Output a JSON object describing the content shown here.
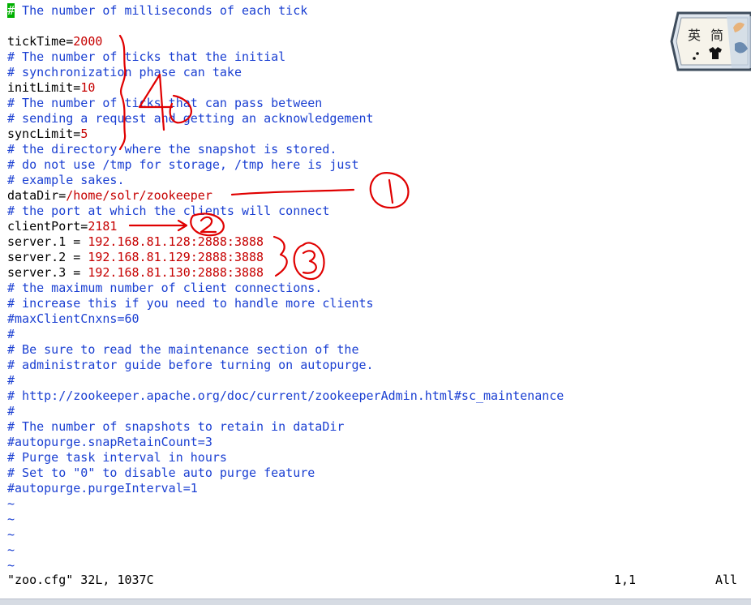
{
  "editor": {
    "lines": [
      {
        "type": "comment",
        "cursor": "#",
        "text": " The number of milliseconds of each tick"
      },
      {
        "type": "blank",
        "text": ""
      },
      {
        "type": "kv",
        "key": "tickTime=",
        "value": "2000"
      },
      {
        "type": "comment",
        "text": "# The number of ticks that the initial"
      },
      {
        "type": "comment",
        "text": "# synchronization phase can take"
      },
      {
        "type": "kv",
        "key": "initLimit=",
        "value": "10"
      },
      {
        "type": "comment",
        "text": "# The number of ticks that can pass between"
      },
      {
        "type": "comment",
        "text": "# sending a request and getting an acknowledgement"
      },
      {
        "type": "kv",
        "key": "syncLimit=",
        "value": "5"
      },
      {
        "type": "comment",
        "text": "# the directory where the snapshot is stored."
      },
      {
        "type": "comment",
        "text": "# do not use /tmp for storage, /tmp here is just"
      },
      {
        "type": "comment",
        "text": "# example sakes."
      },
      {
        "type": "kv",
        "key": "dataDir=",
        "value": "/home/solr/zookeeper"
      },
      {
        "type": "comment",
        "text": "# the port at which the clients will connect"
      },
      {
        "type": "kv",
        "key": "clientPort=",
        "value": "2181"
      },
      {
        "type": "kv",
        "key": "server.1 = ",
        "value": "192.168.81.128:2888:3888"
      },
      {
        "type": "kv",
        "key": "server.2 = ",
        "value": "192.168.81.129:2888:3888"
      },
      {
        "type": "kv",
        "key": "server.3 = ",
        "value": "192.168.81.130:2888:3888"
      },
      {
        "type": "comment",
        "text": "# the maximum number of client connections."
      },
      {
        "type": "comment",
        "text": "# increase this if you need to handle more clients"
      },
      {
        "type": "comment",
        "text": "#maxClientCnxns=60"
      },
      {
        "type": "comment",
        "text": "#"
      },
      {
        "type": "comment",
        "text": "# Be sure to read the maintenance section of the"
      },
      {
        "type": "comment",
        "text": "# administrator guide before turning on autopurge."
      },
      {
        "type": "comment",
        "text": "#"
      },
      {
        "type": "comment",
        "text": "# http://zookeeper.apache.org/doc/current/zookeeperAdmin.html#sc_maintenance"
      },
      {
        "type": "comment",
        "text": "#"
      },
      {
        "type": "comment",
        "text": "# The number of snapshots to retain in dataDir"
      },
      {
        "type": "comment",
        "text": "#autopurge.snapRetainCount=3"
      },
      {
        "type": "comment",
        "text": "# Purge task interval in hours"
      },
      {
        "type": "comment",
        "text": "# Set to \"0\" to disable auto purge feature"
      },
      {
        "type": "comment",
        "text": "#autopurge.purgeInterval=1"
      },
      {
        "type": "tilde",
        "text": "~"
      },
      {
        "type": "tilde",
        "text": "~"
      },
      {
        "type": "tilde",
        "text": "~"
      },
      {
        "type": "tilde",
        "text": "~"
      },
      {
        "type": "tilde",
        "text": "~"
      }
    ]
  },
  "status": {
    "file_info": "\"zoo.cfg\" 32L, 1037C",
    "position": "1,1",
    "scroll": "All"
  },
  "ime": {
    "label_left": "英",
    "label_right": "简",
    "icon": "ime-status-icon"
  },
  "annotations": {
    "marks": [
      "①",
      "②",
      "③",
      "④"
    ],
    "color": "#e00000"
  },
  "colors": {
    "comment": "#1a3fd2",
    "value": "#c60000",
    "cursor": "#00b000"
  }
}
